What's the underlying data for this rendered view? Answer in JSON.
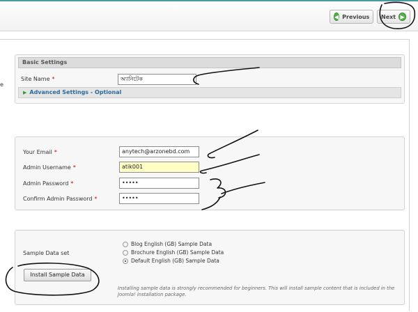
{
  "toolbar": {
    "previous_label": "Previous",
    "next_label": "Next"
  },
  "side_fragment": "e",
  "basic_settings": {
    "header": "Basic Settings",
    "site_name_label": "Site Name",
    "site_name_value": "অ্যানিটেক",
    "advanced_label": "Advanced Settings - Optional"
  },
  "admin": {
    "email_label": "Your Email",
    "email_value": "anytech@arzonebd.com",
    "username_label": "Admin Username",
    "username_value": "atik001",
    "password_label": "Admin Password",
    "password_value": "•••••",
    "confirm_label": "Confirm Admin Password",
    "confirm_value": "•••••"
  },
  "required_mark": "*",
  "sample": {
    "label": "Sample Data set",
    "options": [
      {
        "label": "Blog English (GB) Sample Data",
        "selected": false
      },
      {
        "label": "Brochure English (GB) Sample Data",
        "selected": false
      },
      {
        "label": "Default English (GB) Sample Data",
        "selected": true
      }
    ],
    "install_label": "Install Sample Data",
    "note": "Installing sample data is strongly recommended for beginners. This will install sample content that is included in the Joomla! installation package."
  },
  "colors": {
    "accent_teal": "#4a9aa6",
    "nav_green": "#55b04b",
    "link_blue": "#2b6a9c",
    "required_red": "#cc0000",
    "highlight_yellow": "#ffffc6"
  },
  "icons": {
    "previous": "arrow-left-circle-icon",
    "next": "arrow-right-circle-icon",
    "expand": "triangle-right-icon"
  }
}
